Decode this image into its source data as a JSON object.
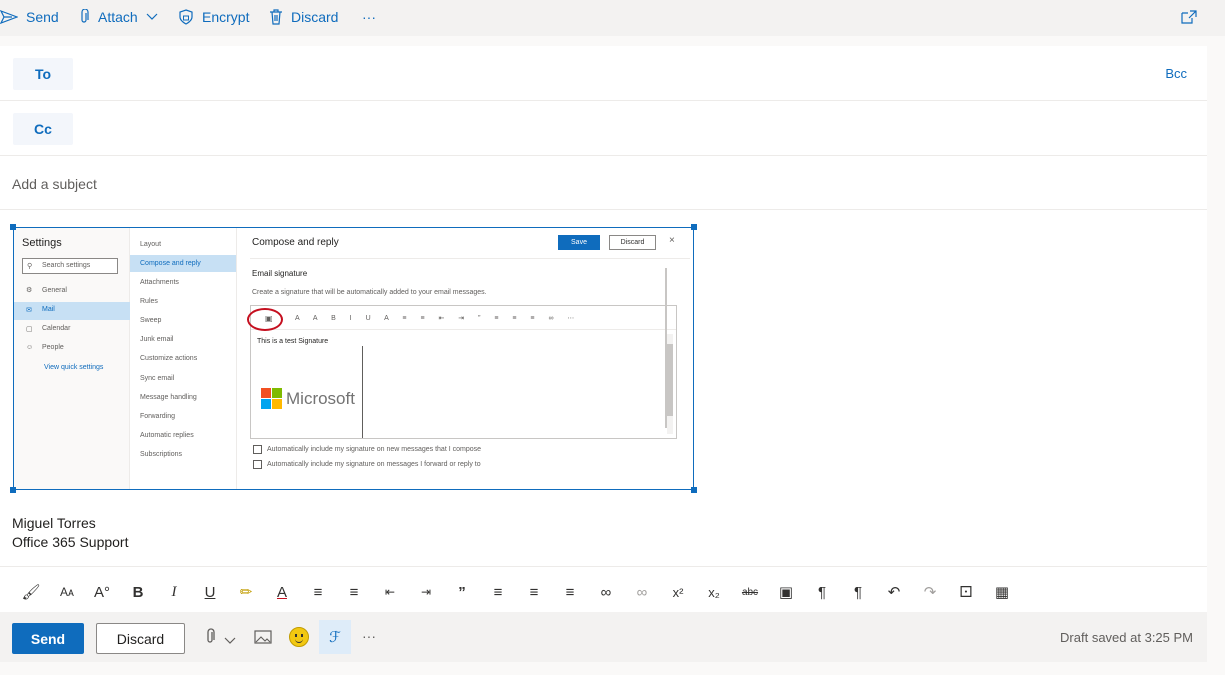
{
  "toolbar": {
    "send_label": "Send",
    "attach_label": "Attach",
    "encrypt_label": "Encrypt",
    "discard_label": "Discard",
    "more_label": "···"
  },
  "recipients": {
    "to_label": "To",
    "cc_label": "Cc",
    "bcc_label": "Bcc"
  },
  "subject": {
    "placeholder": "Add a subject"
  },
  "embedded": {
    "settings_title": "Settings",
    "search_placeholder": "Search settings",
    "left_items": [
      "General",
      "Mail",
      "Calendar",
      "People"
    ],
    "view_quick": "View quick settings",
    "mid_items": [
      "Layout",
      "Compose and reply",
      "Attachments",
      "Rules",
      "Sweep",
      "Junk email",
      "Customize actions",
      "Sync email",
      "Message handling",
      "Forwarding",
      "Automatic replies",
      "Subscriptions"
    ],
    "panel_title": "Compose and reply",
    "save_label": "Save",
    "discard_label": "Discard",
    "sig_heading": "Email signature",
    "sig_desc": "Create a signature that will be automatically added to your email messages.",
    "sig_text": "This is a test Signature",
    "logo_text": "Microsoft",
    "check1": "Automatically include my signature on new messages that I compose",
    "check2": "Automatically include my signature on messages I forward or reply to"
  },
  "signature": {
    "name": "Miguel Torres",
    "title": "Office 365 Support"
  },
  "bottom": {
    "send_label": "Send",
    "discard_label": "Discard",
    "more_label": "···",
    "draft_status": "Draft saved at 3:25 PM"
  },
  "colors": {
    "accent": "#0f6cbd",
    "circle": "#c50f1f"
  }
}
